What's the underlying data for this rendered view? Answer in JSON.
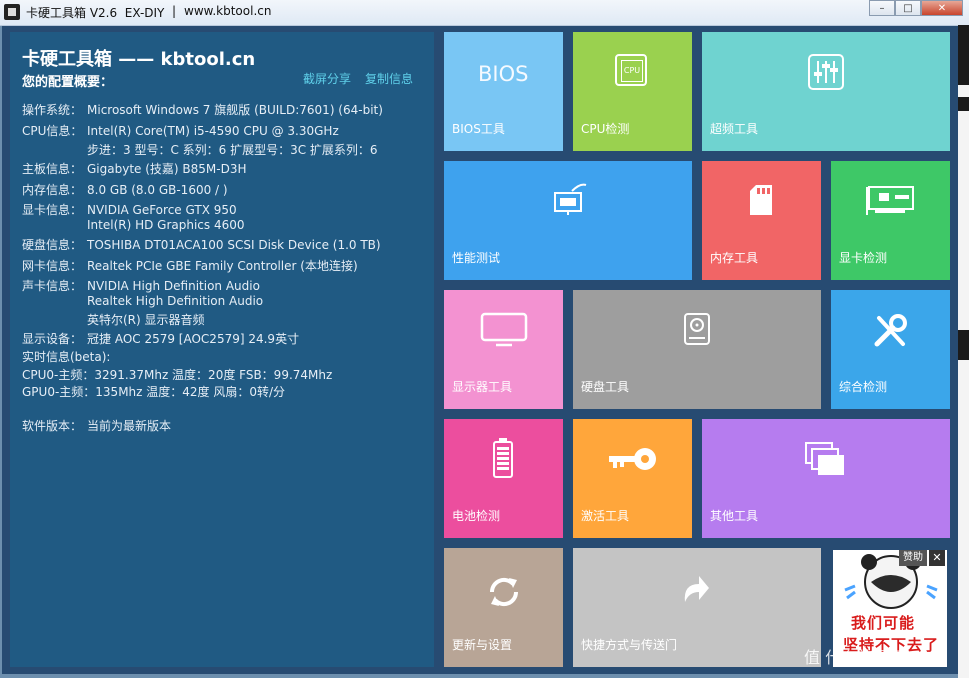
{
  "window": {
    "title": "卡硬工具箱 V2.6  EX-DIY",
    "separator": "|",
    "url": "www.kbtool.cn",
    "minimize_label": "–",
    "maximize_label": "□",
    "close_label": "✕"
  },
  "info": {
    "title": "卡硬工具箱 —— kbtool.cn",
    "subtitle": "您的配置概要：",
    "share_link": "截屏分享",
    "copy_link": "复制信息",
    "rows": [
      {
        "key": "操作系统：",
        "value": "Microsoft Windows 7 旗舰版 (BUILD:7601) (64-bit)"
      },
      {
        "key": "CPU信息：",
        "value": "Intel(R) Core(TM) i5-4590 CPU @ 3.30GHz"
      },
      {
        "key": "",
        "value": "步进：3 型号：C 系列：6 扩展型号：3C 扩展系列：6"
      },
      {
        "key": "主板信息：",
        "value": "Gigabyte (技嘉) B85M-D3H"
      },
      {
        "key": "内存信息：",
        "value": "8.0 GB (8.0 GB-1600 / )"
      },
      {
        "key": "显卡信息：",
        "value": "NVIDIA GeForce GTX 950"
      },
      {
        "key": "",
        "value": "Intel(R) HD Graphics 4600"
      },
      {
        "key": "硬盘信息：",
        "value": "TOSHIBA DT01ACA100 SCSI Disk Device (1.0 TB)"
      },
      {
        "key": "网卡信息：",
        "value": "Realtek PCIe GBE Family Controller (本地连接)"
      },
      {
        "key": "声卡信息：",
        "value": "NVIDIA High Definition Audio"
      },
      {
        "key": "",
        "value": "Realtek High Definition Audio"
      },
      {
        "key": "",
        "value": "英特尔(R) 显示器音频"
      },
      {
        "key": "显示设备：",
        "value": "冠捷 AOC 2579 [AOC2579] 24.9英寸"
      }
    ],
    "realtime_title": "实时信息(beta):",
    "cpu_line": "CPU0-主频：3291.37Mhz 温度：20度 FSB：99.74Mhz",
    "gpu_line": "GPU0-主频：135Mhz 温度：42度 风扇：0转/分",
    "version_key": "软件版本：",
    "version_value": "当前为最新版本"
  },
  "tiles": [
    {
      "label": "BIOS工具",
      "icon": "bios-text-icon",
      "icon_text": "BIOS",
      "color": "#79c6f4"
    },
    {
      "label": "CPU检测",
      "icon": "cpu-icon",
      "icon_text": "CPU",
      "color": "#9ad14f"
    },
    {
      "label": "超频工具",
      "icon": "sliders-icon",
      "color": "#6fd3d0"
    },
    {
      "label": "性能测试",
      "icon": "monitor-gauge-icon",
      "color": "#3ea2ee"
    },
    {
      "label": "内存工具",
      "icon": "memory-card-icon",
      "color": "#f16566"
    },
    {
      "label": "显卡检测",
      "icon": "graphics-card-icon",
      "color": "#3ec867"
    },
    {
      "label": "显示器工具",
      "icon": "display-icon",
      "color": "#f392d1"
    },
    {
      "label": "硬盘工具",
      "icon": "hard-disk-icon",
      "color": "#9e9e9e"
    },
    {
      "label": "综合检测",
      "icon": "tools-icon",
      "color": "#3ba6ea"
    },
    {
      "label": "电池检测",
      "icon": "battery-icon",
      "color": "#ec4e9e"
    },
    {
      "label": "激活工具",
      "icon": "key-icon",
      "color": "#ffa63b"
    },
    {
      "label": "其他工具",
      "icon": "windows-icon",
      "color": "#b67cef"
    },
    {
      "label": "更新与设置",
      "icon": "refresh-icon",
      "color": "#b8a596"
    },
    {
      "label": "快捷方式与传送门",
      "icon": "share-arrow-icon",
      "color": "#c4c4c4"
    }
  ],
  "ad": {
    "help_label": "赞助",
    "close_label": "✕",
    "line1": "我们可能",
    "line2": "坚持不下去了"
  },
  "watermark": "值 什么值得买"
}
